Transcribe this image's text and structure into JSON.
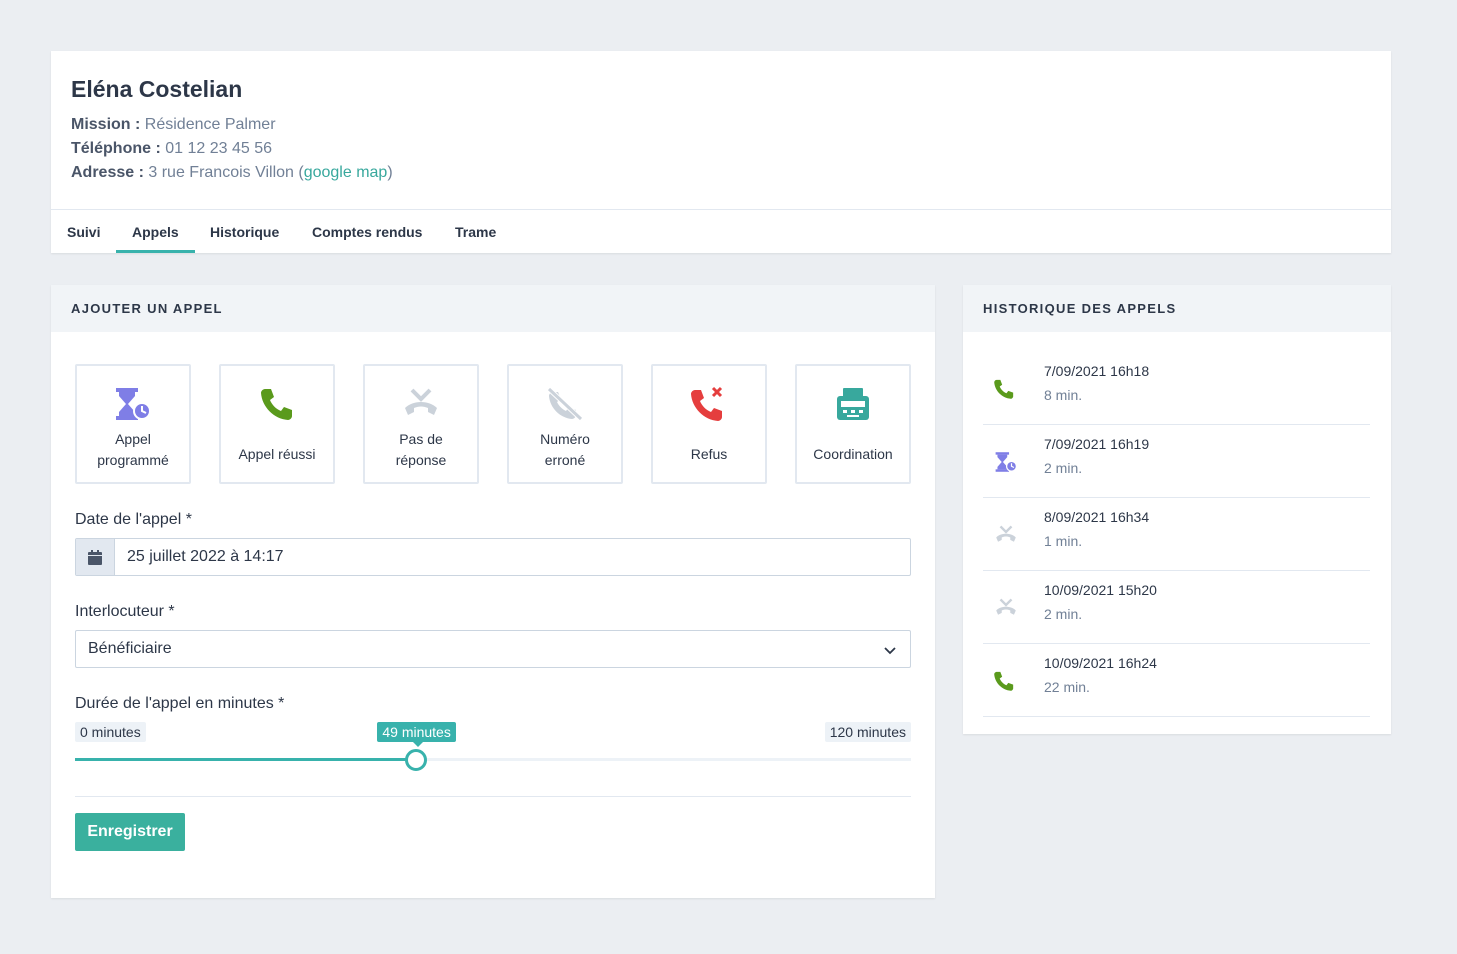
{
  "person": {
    "name": "Eléna Costelian",
    "mission_label": "Mission :",
    "mission_value": "Résidence Palmer",
    "phone_label": "Téléphone :",
    "phone_value": "01 12 23 45 56",
    "address_label": "Adresse :",
    "address_value": "3 rue Francois Villon (",
    "address_link": "google map",
    "address_close": ")"
  },
  "tabs": [
    {
      "label": "Suivi",
      "active": false
    },
    {
      "label": "Appels",
      "active": true
    },
    {
      "label": "Historique",
      "active": false
    },
    {
      "label": "Comptes rendus",
      "active": false
    },
    {
      "label": "Trame",
      "active": false
    }
  ],
  "add_call": {
    "title": "AJOUTER UN APPEL",
    "types": [
      {
        "line1": "Appel",
        "line2": "programmé",
        "icon": "hourglass-clock-icon",
        "color": "#7f7ee6"
      },
      {
        "line1": "Appel réussi",
        "line2": "",
        "icon": "phone-icon",
        "color": "#5a9a1c"
      },
      {
        "line1": "Pas de",
        "line2": "réponse",
        "icon": "phone-hangup-icon",
        "color": "#cbd2da"
      },
      {
        "line1": "Numéro",
        "line2": "erroné",
        "icon": "phone-slash-icon",
        "color": "#cbd2da"
      },
      {
        "line1": "Refus",
        "line2": "",
        "icon": "phone-reject-icon",
        "color": "#e53e3e"
      },
      {
        "line1": "Coordination",
        "line2": "",
        "icon": "fax-icon",
        "color": "#38a89d"
      }
    ],
    "date_label": "Date de l'appel *",
    "date_value": "25 juillet 2022 à 14:17",
    "interlocutor_label": "Interlocuteur *",
    "interlocutor_value": "Bénéficiaire",
    "duration_label": "Durée de l'appel en minutes *",
    "duration_min_label": "0 minutes",
    "duration_max_label": "120 minutes",
    "duration_current_label": "49 minutes",
    "duration_min": 0,
    "duration_max": 120,
    "duration_value": 49,
    "save_label": "Enregistrer"
  },
  "history": {
    "title": "HISTORIQUE DES APPELS",
    "items": [
      {
        "date": "7/09/2021 16h18",
        "duration": "8 min.",
        "icon": "phone-icon"
      },
      {
        "date": "7/09/2021 16h19",
        "duration": "2 min.",
        "icon": "hourglass-clock-icon"
      },
      {
        "date": "8/09/2021 16h34",
        "duration": "1 min.",
        "icon": "phone-hangup-icon"
      },
      {
        "date": "10/09/2021 15h20",
        "duration": "2 min.",
        "icon": "phone-hangup-icon"
      },
      {
        "date": "10/09/2021 16h24",
        "duration": "22 min.",
        "icon": "phone-icon"
      }
    ]
  },
  "colors": {
    "accent": "#38b2ac",
    "success": "#5a9a1c",
    "danger": "#e53e3e",
    "scheduled": "#7f7ee6",
    "muted": "#cbd2da"
  }
}
